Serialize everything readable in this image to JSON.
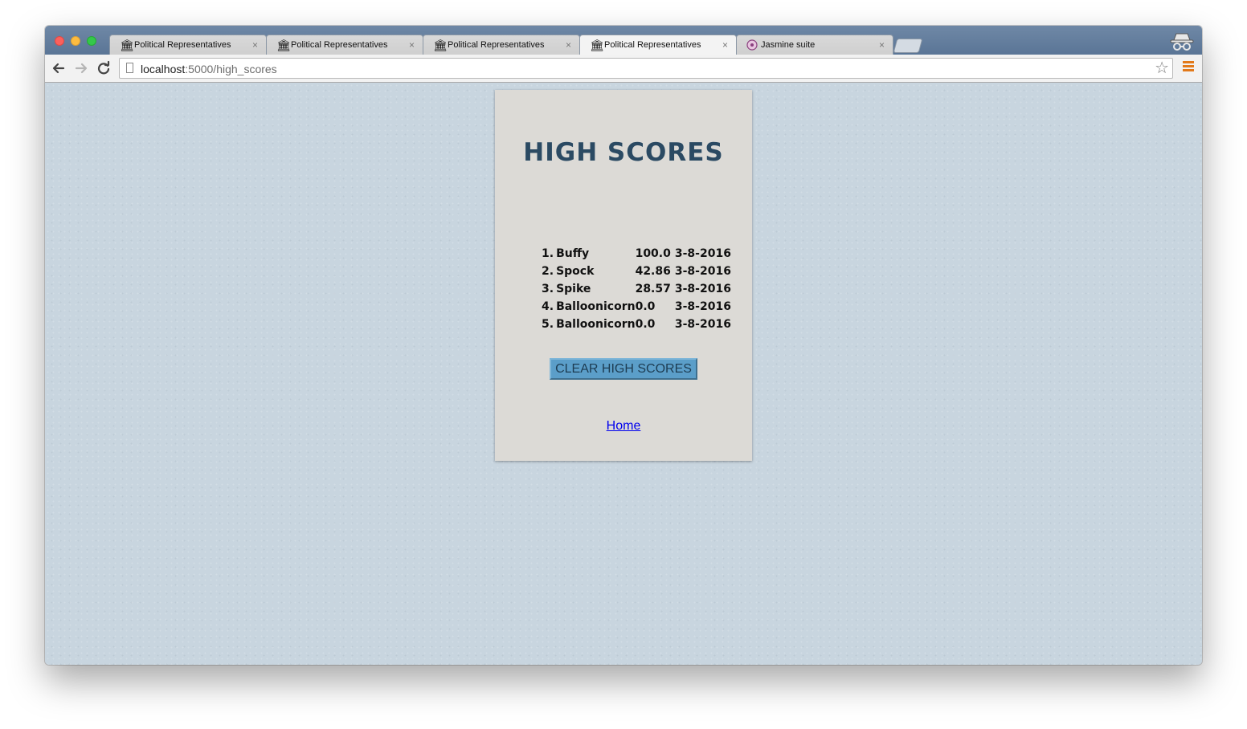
{
  "browser": {
    "tabs": [
      {
        "title": "Political Representatives",
        "favicon": "institution-icon",
        "active": false
      },
      {
        "title": "Political Representatives",
        "favicon": "institution-icon",
        "active": false
      },
      {
        "title": "Political Representatives",
        "favicon": "institution-icon",
        "active": false
      },
      {
        "title": "Political Representatives",
        "favicon": "institution-icon",
        "active": true
      },
      {
        "title": "Jasmine suite",
        "favicon": "jasmine-icon",
        "active": false
      }
    ],
    "tab_close_glyph": "×",
    "url_host": "localhost",
    "url_path": ":5000/high_scores"
  },
  "page": {
    "title": "HIGH SCORES",
    "scores": [
      {
        "rank": "1.",
        "name": "Buffy",
        "score": "100.0",
        "date": "3-8-2016"
      },
      {
        "rank": "2.",
        "name": "Spock",
        "score": "42.86",
        "date": "3-8-2016"
      },
      {
        "rank": "3.",
        "name": "Spike",
        "score": "28.57",
        "date": "3-8-2016"
      },
      {
        "rank": "4.",
        "name": "Balloonicorn",
        "score": "0.0",
        "date": "3-8-2016"
      },
      {
        "rank": "5.",
        "name": "Balloonicorn",
        "score": "0.0",
        "date": "3-8-2016"
      }
    ],
    "clear_button_label": "CLEAR HIGH SCORES",
    "home_link_label": "Home"
  },
  "colors": {
    "title": "#2b4a63",
    "button": "#5b9ec9",
    "page_background": "#c8d5df",
    "card_background": "#dcdad6"
  }
}
